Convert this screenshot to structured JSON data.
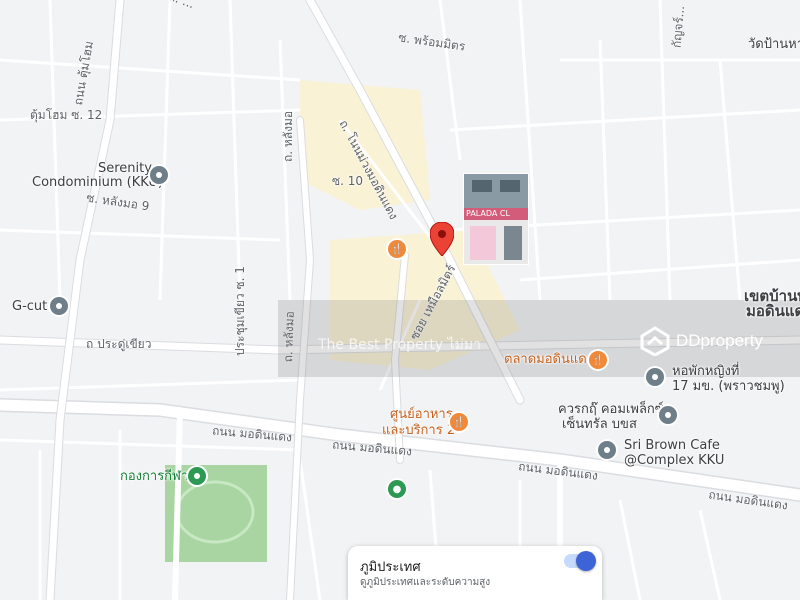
{
  "map": {
    "road_labels": {
      "top_cut": "ถ. ...",
      "phrom_mit": "ซ. พร้อมมิตร",
      "ratchathura": "กัญจร์...",
      "tum_hom_12": "ตุ้มโฮม ซ. 12",
      "tum_hom_road": "ถนน ตุ้มโฮม",
      "lang_mo": "ถ. หลังมอ",
      "soi_10": "ซ. 10",
      "lang_mo_9": "ซ. หลังมอ 9",
      "khon_kaen_bot": "ถ. โนนม่วงมอดินแดง",
      "soi_muang": "ซอย เหมือลมิตร์",
      "pracha_soi1": "ประชุมเขียว ซ. 1",
      "pracha": "ถ ประดู่เขียว",
      "lang_mo2": "ถ. หลังมอ",
      "mo_din_daeng_1": "ถนน มอดินแดง",
      "mo_din_daeng_2": "ถนน มอดินแดง",
      "mo_din_daeng_3": "ถนน มอดินแดง",
      "mo_din_daeng_4": "ถนน มอดินแดง"
    },
    "places": {
      "wat": "วัดป้านหาว",
      "serenity_1": "Serenity",
      "serenity_2": "Condominium (KKU)",
      "gcut": "G-cut",
      "district_1": "เขตบ้านพ",
      "district_2": "มอดินแด",
      "market": "ตลาดมอดินแดง",
      "dorm_1": "หอพักหญิงที่",
      "dorm_2": "17 มข. (พราวชมพู)",
      "food_1": "ศูนย์อาหาร",
      "food_2": "และบริการ 2",
      "complex_1": "ควรกฤ๊ คอมเพล็กซ์",
      "complex_2": "เซ็นทรัล บขส",
      "cafe_1": "Sri Brown Cafe",
      "cafe_2": "@Complex KKU",
      "sport": "กองการกีฬา"
    },
    "photo_sign": "PALADA CL"
  },
  "watermark": {
    "text": "The Best Property ไม่มา",
    "logo": "DDproperty"
  },
  "terrain_card": {
    "title": "ภูมิประเทศ",
    "subtitle": "ดูภูมิประเทศและระดับความสูง",
    "enabled": true
  },
  "colors": {
    "land": "#f1f3f4",
    "road": "#ffffff",
    "road_outline": "#dadce0",
    "campus_tint": "#fbf2d2",
    "park": "#a8d5a2",
    "pin": "#ea4335",
    "toggle": "#3c64d6"
  }
}
